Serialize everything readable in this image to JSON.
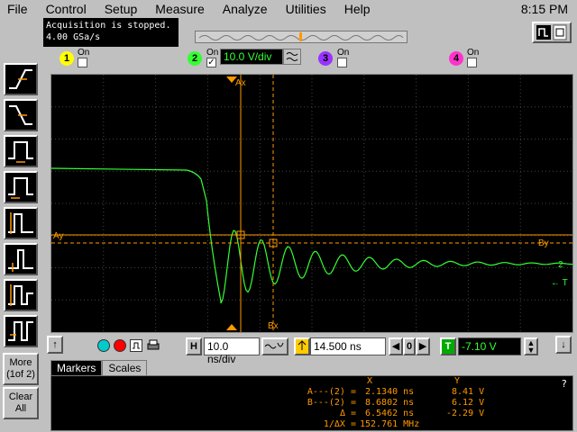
{
  "menu": [
    "File",
    "Control",
    "Setup",
    "Measure",
    "Analyze",
    "Utilities",
    "Help"
  ],
  "clock": "8:15 PM",
  "status": {
    "line1": "Acquisition is stopped.",
    "line2": "4.00 GSa/s"
  },
  "left_buttons": [
    {
      "name": "rising-edge-trigger-icon"
    },
    {
      "name": "falling-edge-trigger-icon"
    },
    {
      "name": "pulse-width-trigger-icon"
    },
    {
      "name": "pulse-width-trigger-alt-icon"
    },
    {
      "name": "setup-hold-trigger-icon"
    },
    {
      "name": "glitch-trigger-icon"
    },
    {
      "name": "runt-trigger-icon"
    },
    {
      "name": "timeout-trigger-icon"
    }
  ],
  "more_button": {
    "line1": "More",
    "line2": "(1of 2)"
  },
  "clear_button": {
    "line1": "Clear",
    "line2": "All"
  },
  "channels": [
    {
      "num": "1",
      "on_label": "On",
      "checked": false,
      "color": "#ffff00"
    },
    {
      "num": "2",
      "on_label": "On",
      "checked": true,
      "color": "#33ff33",
      "scale": "10.0 V/div"
    },
    {
      "num": "3",
      "on_label": "On",
      "checked": false,
      "color": "#9933ff"
    },
    {
      "num": "4",
      "on_label": "On",
      "checked": false,
      "color": "#ff33cc"
    }
  ],
  "markers": {
    "ax": "Ax",
    "bx": "Bx",
    "ay": "Ay",
    "by": "By"
  },
  "trace_labels": {
    "ch": "2",
    "trig": "← T"
  },
  "timebase": {
    "h_label": "H",
    "scale": "10.0 ns/div",
    "delay": "14.500 ns",
    "trigger_label": "T",
    "trigger_level": "-7.10 V",
    "delay_ref": "0"
  },
  "tabs": [
    {
      "label": "Markers",
      "active": true
    },
    {
      "label": "Scales",
      "active": false
    }
  ],
  "measurements": {
    "header_x": "X",
    "header_y": "Y",
    "rows": [
      {
        "label": "A---(2) =",
        "x": "2.1340 ns",
        "y": "8.41 V"
      },
      {
        "label": "B---(2) =",
        "x": "8.6802 ns",
        "y": "6.12 V"
      },
      {
        "label": "Δ =",
        "x": "6.5462 ns",
        "y": "-2.29 V"
      },
      {
        "label": "1/ΔX =",
        "x": "152.761 MHz",
        "y": ""
      }
    ],
    "help": "?"
  },
  "colors": {
    "trace": "#33ff33",
    "marker": "#ff9900",
    "grid": "#555555"
  }
}
